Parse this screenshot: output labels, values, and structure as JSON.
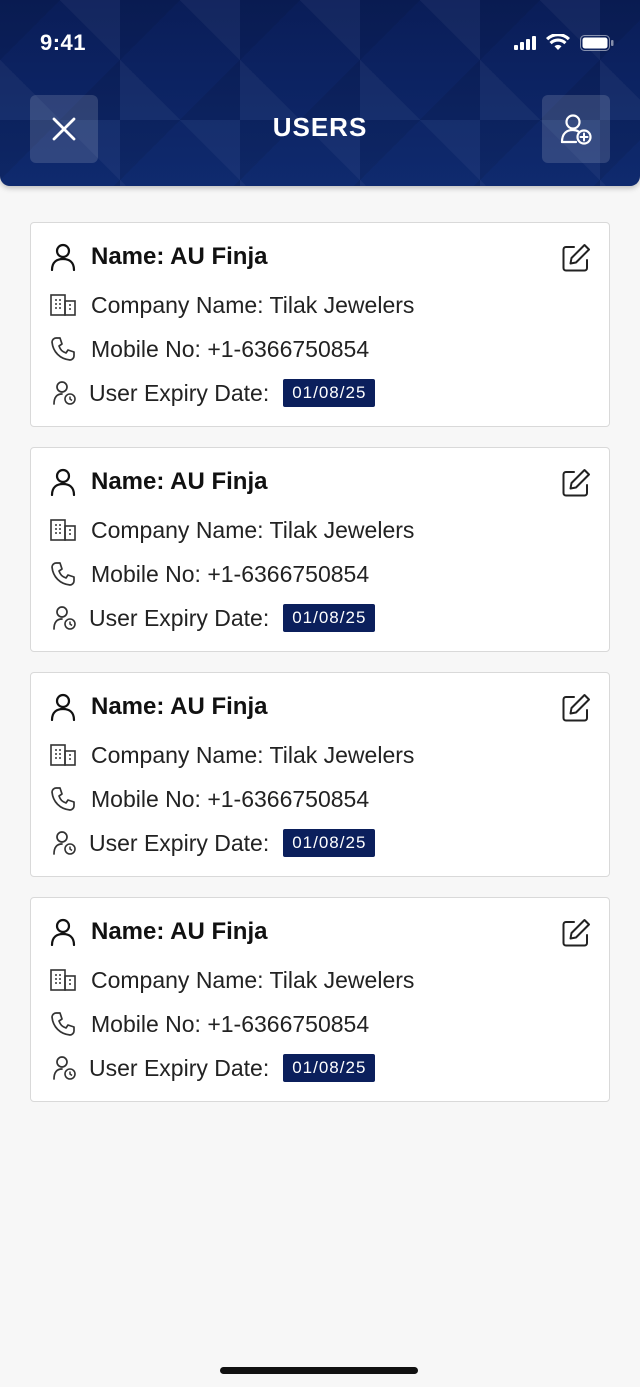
{
  "status_bar": {
    "time": "9:41"
  },
  "header": {
    "title": "USERS"
  },
  "colors": {
    "header_bg": "#0b1f5c",
    "badge_bg": "#0b1f5c",
    "page_bg": "#f7f7f7"
  },
  "users": [
    {
      "name": "Name: AU Finja",
      "company": "Company Name: Tilak Jewelers",
      "mobile": "Mobile No: +1-6366750854",
      "expiry_label": "User Expiry Date:",
      "expiry_date": "01/08/25"
    },
    {
      "name": "Name: AU Finja",
      "company": "Company Name: Tilak Jewelers",
      "mobile": "Mobile No: +1-6366750854",
      "expiry_label": "User Expiry Date:",
      "expiry_date": "01/08/25"
    },
    {
      "name": "Name: AU Finja",
      "company": "Company Name: Tilak Jewelers",
      "mobile": "Mobile No: +1-6366750854",
      "expiry_label": "User Expiry Date:",
      "expiry_date": "01/08/25"
    },
    {
      "name": "Name: AU Finja",
      "company": "Company Name: Tilak Jewelers",
      "mobile": "Mobile No: +1-6366750854",
      "expiry_label": "User Expiry Date:",
      "expiry_date": "01/08/25"
    }
  ]
}
